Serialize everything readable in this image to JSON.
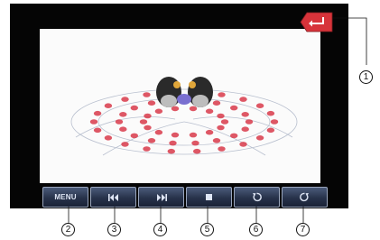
{
  "player": {
    "controls": [
      {
        "id": "menu",
        "label": "MENU",
        "icon": "none"
      },
      {
        "id": "prev",
        "label": "",
        "icon": "skip-previous-icon"
      },
      {
        "id": "next",
        "label": "",
        "icon": "skip-next-icon"
      },
      {
        "id": "stop",
        "label": "",
        "icon": "stop-icon"
      },
      {
        "id": "rotate-left",
        "label": "",
        "icon": "rotate-left-icon"
      },
      {
        "id": "rotate-right",
        "label": "",
        "icon": "rotate-right-icon"
      }
    ],
    "back_icon": "back-arrow-icon",
    "back_color": "#d7333a"
  },
  "callouts": {
    "c1": "1",
    "c2": "2",
    "c3": "3",
    "c4": "4",
    "c5": "5",
    "c6": "6",
    "c7": "7"
  }
}
